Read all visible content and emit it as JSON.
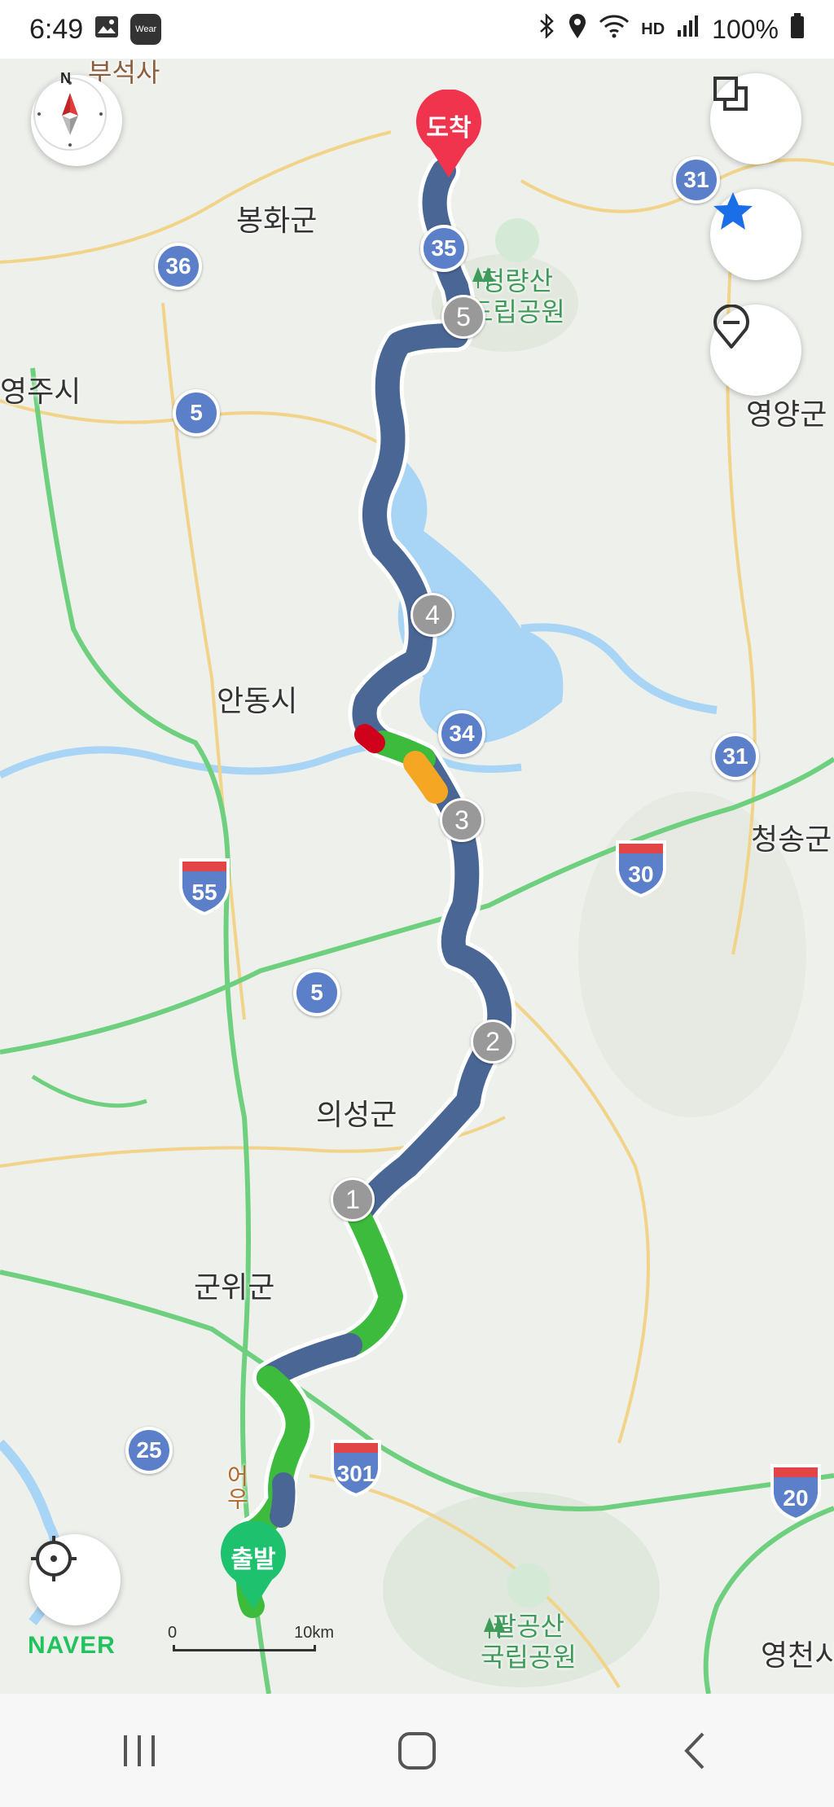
{
  "status_bar": {
    "time": "6:49",
    "wear_label": "Wear",
    "battery": "100%",
    "hd_label": "HD"
  },
  "map": {
    "place_labels": [
      {
        "id": "bonghwa",
        "text": "봉화군"
      },
      {
        "id": "yeongju",
        "text": "영주시"
      },
      {
        "id": "yeongyang",
        "text": "영양군"
      },
      {
        "id": "andong",
        "text": "안동시"
      },
      {
        "id": "cheongsong",
        "text": "청송군"
      },
      {
        "id": "uiseong",
        "text": "의성군"
      },
      {
        "id": "gunwi",
        "text": "군위군"
      },
      {
        "id": "yeongcheon",
        "text": "영천시"
      },
      {
        "id": "buseoksa",
        "text": "부석사"
      }
    ],
    "parks": [
      {
        "id": "cheongnyangsan",
        "line1": "청량산",
        "line2": "도립공원"
      },
      {
        "id": "palgongsan",
        "line1": "팔공산",
        "line2": "국립공원"
      }
    ],
    "road_label": "어우",
    "route_shields": [
      "31",
      "36",
      "35",
      "5",
      "34",
      "31",
      "5",
      "25"
    ],
    "highway_shields": [
      "55",
      "30",
      "301",
      "20"
    ],
    "waypoints": [
      "1",
      "2",
      "3",
      "4",
      "5"
    ],
    "destination_label": "도착",
    "origin_label": "출발",
    "scale": {
      "start": "0",
      "end": "10km"
    },
    "brand": "NAVER",
    "compass_north": "N",
    "colors": {
      "route": "#4a6694",
      "traffic_smooth": "#3dbb3d",
      "traffic_slow": "#f5a623",
      "traffic_jam": "#d0021b",
      "destination": "#f0344d",
      "origin": "#1ec16e",
      "expressway": "#6ed07e",
      "water": "#a8d4f5"
    }
  },
  "controls": {
    "layers_icon": "layers-icon",
    "favorite_icon": "star-icon",
    "place_icon": "map-pin-icon",
    "locate_icon": "locate-icon",
    "compass_icon": "compass-icon"
  },
  "nav_bar": {
    "recents": "recents-icon",
    "home": "home-icon",
    "back": "back-icon"
  }
}
